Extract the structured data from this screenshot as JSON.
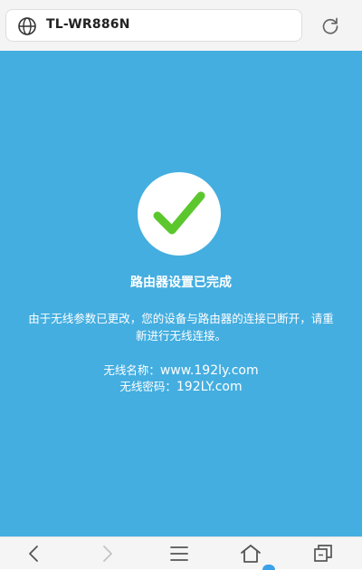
{
  "address_bar": {
    "url": "TL-WR886N",
    "left_icon": "globe-icon",
    "right_icon": "reload-icon"
  },
  "colors": {
    "background": "#44aee0",
    "check": "#5bc72c",
    "text": "#ffffff"
  },
  "main": {
    "status_icon": "checkmark-icon",
    "title": "路由器设置已完成",
    "description": "由于无线参数已更改，您的设备与路由器的连接已断开，请重新进行无线连接。",
    "wifi_name_label": "无线名称：",
    "wifi_name_value": "www.192ly.com",
    "wifi_password_label": "无线密码：",
    "wifi_password_value": "192LY.com"
  },
  "bottom_nav": {
    "icons": [
      "back-arrow-icon",
      "forward-arrow-icon",
      "menu-icon",
      "home-icon",
      "tabs-icon"
    ]
  }
}
